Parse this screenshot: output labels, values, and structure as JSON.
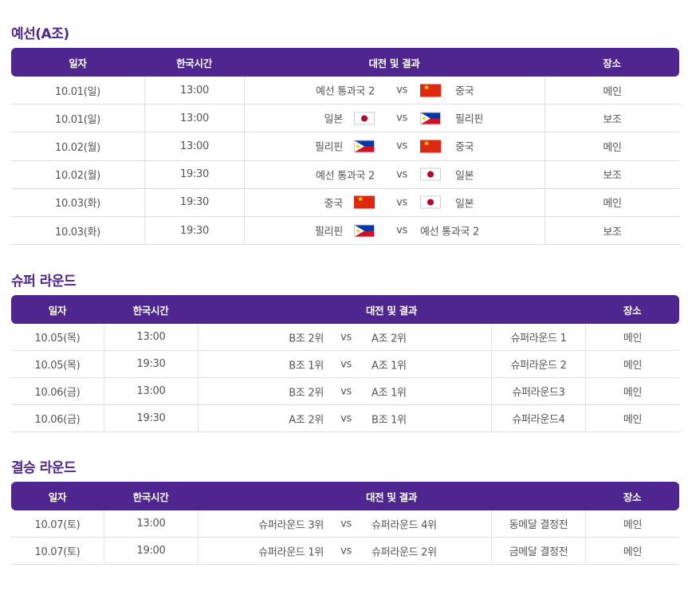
{
  "sections": [
    {
      "title": "예선(A조)",
      "headers": [
        "일자",
        "한국시간",
        "대전 및 결과",
        "장소"
      ],
      "rows": [
        {
          "date": "10.01(일)",
          "time": "13:00",
          "home": "예선 통과국 2",
          "home_flag": "",
          "vs": "vs",
          "away": "중국",
          "away_flag": "china",
          "venue": "메인"
        },
        {
          "date": "10.01(일)",
          "time": "13:00",
          "home": "일본",
          "home_flag": "japan",
          "vs": "vs",
          "away": "필리핀",
          "away_flag": "philippines",
          "venue": "보조"
        },
        {
          "date": "10.02(월)",
          "time": "13:00",
          "home": "필리핀",
          "home_flag": "philippines",
          "vs": "vs",
          "away": "중국",
          "away_flag": "china",
          "venue": "메인"
        },
        {
          "date": "10.02(월)",
          "time": "19:30",
          "home": "예선 통과국 2",
          "home_flag": "",
          "vs": "vs",
          "away": "일본",
          "away_flag": "japan",
          "venue": "보조"
        },
        {
          "date": "10.03(화)",
          "time": "19:30",
          "home": "중국",
          "home_flag": "china",
          "vs": "vs",
          "away": "일본",
          "away_flag": "japan",
          "venue": "메인"
        },
        {
          "date": "10.03(화)",
          "time": "19:30",
          "home": "필리핀",
          "home_flag": "philippines",
          "vs": "vs",
          "away": "예선 통과국 2",
          "away_flag": "",
          "venue": "보조"
        }
      ]
    },
    {
      "title": "슈퍼 라운드",
      "headers": [
        "일자",
        "한국시간",
        "대전 및 결과",
        "장소"
      ],
      "rows": [
        {
          "date": "10.05(목)",
          "time": "13:00",
          "home": "B조 2위",
          "vs": "vs",
          "away": "A조 2위",
          "note": "슈퍼라운드 1",
          "venue": "메인"
        },
        {
          "date": "10.05(목)",
          "time": "19:30",
          "home": "B조 1위",
          "vs": "vs",
          "away": "A조 1위",
          "note": "슈퍼라운드 2",
          "venue": "메인"
        },
        {
          "date": "10.06(금)",
          "time": "13:00",
          "home": "B조 2위",
          "vs": "vs",
          "away": "A조 1위",
          "note": "슈퍼라운드3",
          "venue": "메인"
        },
        {
          "date": "10.06(금)",
          "time": "19:30",
          "home": "A조 2위",
          "vs": "vs",
          "away": "B조 1위",
          "note": "슈퍼라운드4",
          "venue": "메인"
        }
      ]
    },
    {
      "title": "결승 라운드",
      "headers": [
        "일자",
        "한국시간",
        "대전 및 결과",
        "장소"
      ],
      "rows": [
        {
          "date": "10.07(토)",
          "time": "13:00",
          "home": "슈퍼라운드 3위",
          "vs": "vs",
          "away": "슈퍼라운드 4위",
          "note": "동메달 결정전",
          "venue": "메인"
        },
        {
          "date": "10.07(토)",
          "time": "19:00",
          "home": "슈퍼라운드 1위",
          "vs": "vs",
          "away": "슈퍼라운드 2위",
          "note": "금메달 결정전",
          "venue": "메인"
        }
      ]
    }
  ],
  "colors": {
    "header_bg": "#4f2590",
    "title": "#4f2590",
    "border": "#dddddd"
  }
}
